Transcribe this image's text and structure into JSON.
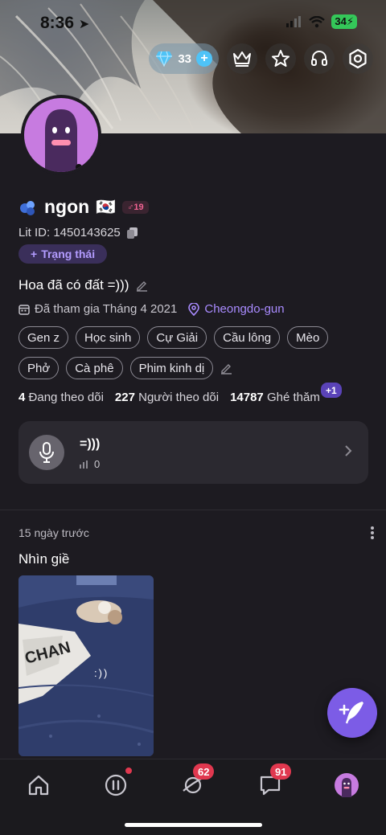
{
  "status_bar": {
    "time": "8:36",
    "battery": "34"
  },
  "topbar": {
    "gem_count": "33",
    "icons": [
      "diamond-icon",
      "crown-icon",
      "star-icon",
      "headset-icon",
      "settings-icon"
    ]
  },
  "profile": {
    "name": "ngon",
    "flag": "🇰🇷",
    "level": "♂19",
    "lit_id": "Lit ID: 1450143625",
    "status_button": "Trạng thái",
    "bio": "Hoa đã có đất =)))",
    "joined": "Đã tham gia Tháng 4 2021",
    "location": "Cheongdo-gun",
    "tags": [
      "Gen z",
      "Học sinh",
      "Cự Giải",
      "Cầu lông",
      "Mèo",
      "Phở",
      "Cà phê",
      "Phim kinh dị"
    ]
  },
  "stats": {
    "following_count": "4",
    "following_label": "Đang theo dõi",
    "followers_count": "227",
    "followers_label": "Người theo dõi",
    "visits_count": "14787",
    "visits_label": "Ghé thăm",
    "visits_badge": "+1"
  },
  "voice_card": {
    "title": "=)))",
    "plays": "0"
  },
  "post": {
    "date": "15 ngày trước",
    "text": "Nhìn giề",
    "image_caption": ":))"
  },
  "tabbar": {
    "explore_badge": "62",
    "messages_badge": "91"
  },
  "colors": {
    "accent": "#7c5ce6",
    "badge": "#e0384f",
    "background": "#1d1b21",
    "location": "#a98bff"
  }
}
